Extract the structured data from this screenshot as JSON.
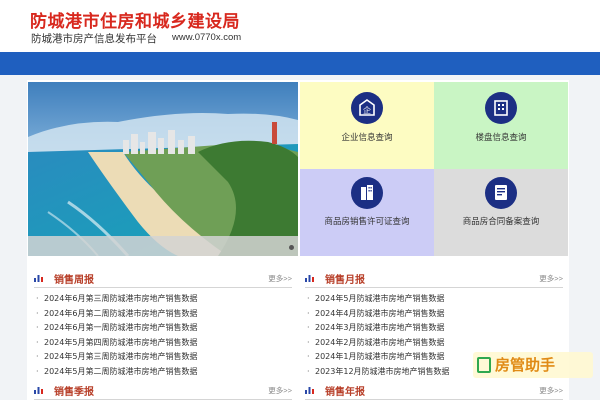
{
  "header": {
    "title": "防城港市住房和城乡建设局",
    "subtitle": "防城港市房产信息发布平台",
    "url": "www.0770x.com"
  },
  "tiles": [
    {
      "label": "企业信息查询",
      "icon": "enterprise-icon",
      "color": "#fdfcc2"
    },
    {
      "label": "楼盘信息查询",
      "icon": "building-info-icon",
      "color": "#c9f5c4"
    },
    {
      "label": "商品房销售许可证查询",
      "icon": "sales-permit-icon",
      "color": "#ccccf6"
    },
    {
      "label": "商品房合同备案查询",
      "icon": "contract-filing-icon",
      "color": "#dcdcdc"
    }
  ],
  "weekly": {
    "title": "销售周报",
    "more": "更多>>",
    "items": [
      "2024年6月第三周防城港市房地产销售数据",
      "2024年6月第二周防城港市房地产销售数据",
      "2024年6月第一周防城港市房地产销售数据",
      "2024年5月第四周防城港市房地产销售数据",
      "2024年5月第三周防城港市房地产销售数据",
      "2024年5月第二周防城港市房地产销售数据"
    ]
  },
  "monthly": {
    "title": "销售月报",
    "more": "更多>>",
    "items": [
      "2024年5月防城港市房地产销售数据",
      "2024年4月防城港市房地产销售数据",
      "2024年3月防城港市房地产销售数据",
      "2024年2月防城港市房地产销售数据",
      "2024年1月防城港市房地产销售数据",
      "2023年12月防城港市房地产销售数据"
    ]
  },
  "quarterly": {
    "title": "销售季报",
    "more": "更多>>"
  },
  "yearly": {
    "title": "销售年报",
    "more": "更多>>"
  },
  "watermark": {
    "text": "房管助手"
  },
  "colors": {
    "nav": "#1f5fbf",
    "title": "#d8281e",
    "icon_bg": "#1c2f84",
    "section_title": "#b8402a"
  }
}
